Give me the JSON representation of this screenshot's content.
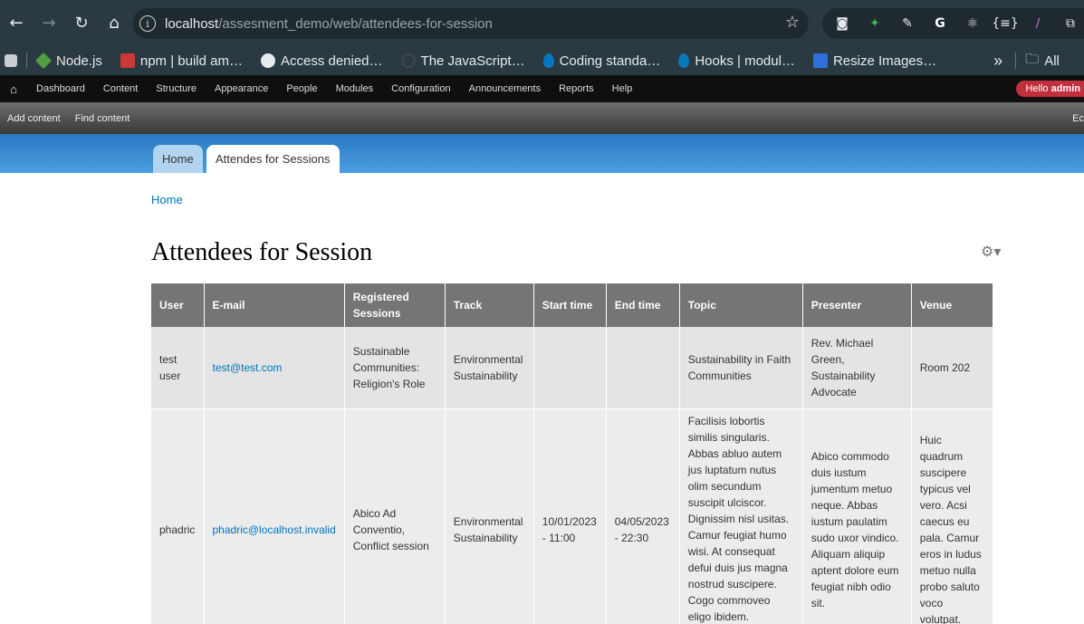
{
  "browser": {
    "url_host": "localhost",
    "url_path": "/assesment_demo/web/attendees-for-session",
    "bookmarks": [
      {
        "label": "Node.js",
        "color": "#539e43"
      },
      {
        "label": "npm | build am…",
        "color": "#cb3837"
      },
      {
        "label": "Access denied…",
        "color": "#e8eaed"
      },
      {
        "label": "The JavaScript…",
        "color": "#444444"
      },
      {
        "label": "Coding standa…",
        "color": "#0678be"
      },
      {
        "label": "Hooks | modul…",
        "color": "#0678be"
      },
      {
        "label": "Resize Images…",
        "color": "#2f6fdb"
      }
    ],
    "bookmarks_more": "»",
    "all_bookmarks": "All"
  },
  "toolbar": {
    "items": [
      "Dashboard",
      "Content",
      "Structure",
      "Appearance",
      "People",
      "Modules",
      "Configuration",
      "Announcements",
      "Reports",
      "Help"
    ],
    "hello_prefix": "Hello ",
    "hello_user": "admin"
  },
  "shortcuts": {
    "add_content": "Add content",
    "find_content": "Find content",
    "edit_shortcuts": "Ec"
  },
  "tabs": {
    "home": "Home",
    "active": "Attendes for Sessions"
  },
  "breadcrumb": "Home",
  "page_title": "Attendees for Session",
  "table": {
    "headers": [
      "User",
      "E-mail",
      "Registered Sessions",
      "Track",
      "Start time",
      "End time",
      "Topic",
      "Presenter",
      "Venue"
    ],
    "rows": [
      {
        "user": "test user",
        "email": "test@test.com",
        "sessions": "Sustainable Communities: Religion's Role",
        "track": "Environmental Sustainability",
        "start": "",
        "end": "",
        "topic": "Sustainability in Faith Communities",
        "presenter": "Rev. Michael Green, Sustainability Advocate",
        "venue": "Room 202"
      },
      {
        "user": "phadric",
        "email": "phadric@localhost.invalid",
        "sessions": "Abico Ad Conventio, Conflict session",
        "track": "Environmental Sustainability",
        "start": "10/01/2023 - 11:00",
        "end": "04/05/2023 - 22:30",
        "topic": "Facilisis lobortis similis singularis. Abbas abluo autem jus luptatum nutus olim secundum suscipit ulciscor. Dignissim nisl usitas. Camur feugiat humo wisi. At consequat defui duis jus magna nostrud suscipere. Cogo commoveo eligo ibidem. Appellatio illum",
        "presenter": "Abico commodo duis iustum jumentum metuo neque. Abbas iustum paulatim sudo uxor vindico. Aliquam aliquip aptent dolore eum feugiat nibh odio sit.",
        "venue": "Huic quadrum suscipere typicus vel vero. Acsi caecus eu pala. Camur eros in ludus metuo nulla probo saluto voco volutpat."
      }
    ]
  }
}
